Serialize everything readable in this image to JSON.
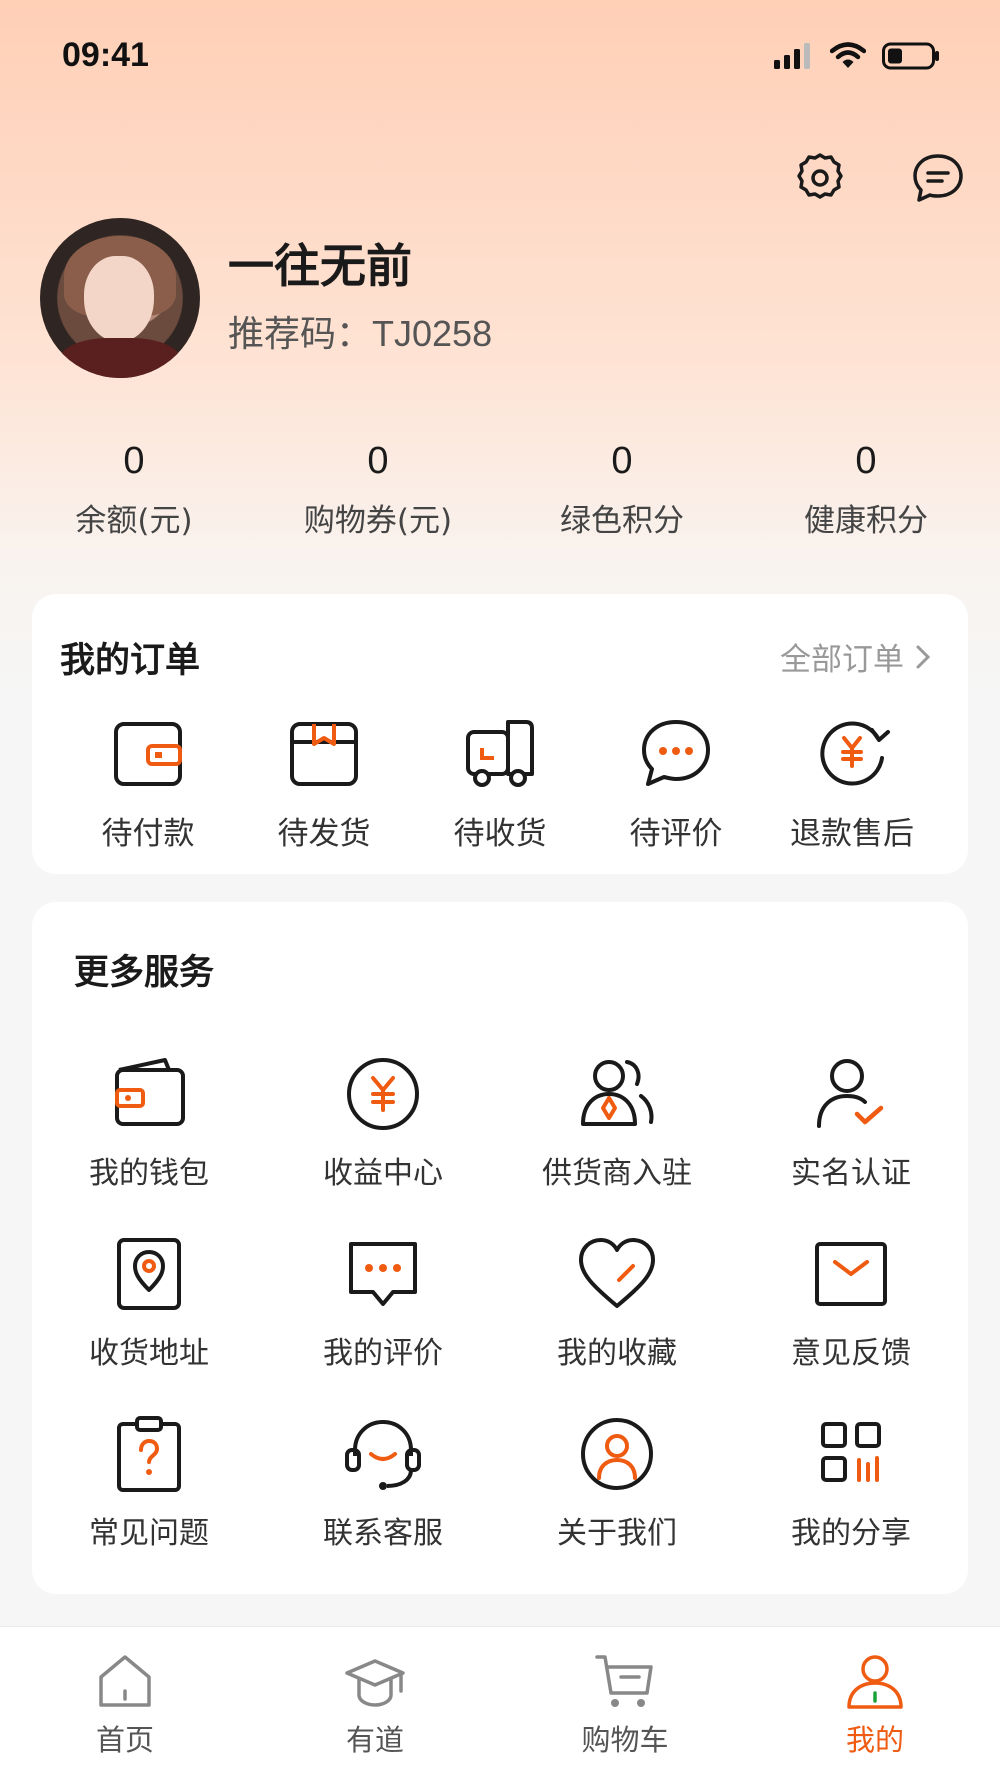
{
  "status_bar": {
    "time": "09:41",
    "signal_icon": "signal-icon",
    "wifi_icon": "wifi-icon",
    "battery_icon": "battery-icon"
  },
  "header": {
    "settings_icon": "gear-icon",
    "message_icon": "message-icon"
  },
  "profile": {
    "name": "一往无前",
    "referral_label": "推荐码：",
    "referral_code": "TJ0258"
  },
  "stats": [
    {
      "value": "0",
      "label": "余额(元)"
    },
    {
      "value": "0",
      "label": "购物券(元)"
    },
    {
      "value": "0",
      "label": "绿色积分"
    },
    {
      "value": "0",
      "label": "健康积分"
    }
  ],
  "orders": {
    "title": "我的订单",
    "all_label": "全部订单",
    "items": [
      {
        "label": "待付款",
        "icon": "wallet-icon"
      },
      {
        "label": "待发货",
        "icon": "box-icon"
      },
      {
        "label": "待收货",
        "icon": "truck-icon"
      },
      {
        "label": "待评价",
        "icon": "chat-bubble-icon"
      },
      {
        "label": "退款售后",
        "icon": "refund-icon"
      }
    ]
  },
  "services": {
    "title": "更多服务",
    "items": [
      {
        "label": "我的钱包",
        "icon": "wallet-icon"
      },
      {
        "label": "收益中心",
        "icon": "yuan-coin-icon"
      },
      {
        "label": "供货商入驻",
        "icon": "supplier-icon"
      },
      {
        "label": "实名认证",
        "icon": "user-check-icon"
      },
      {
        "label": "收货地址",
        "icon": "location-pin-icon"
      },
      {
        "label": "我的评价",
        "icon": "comment-icon"
      },
      {
        "label": "我的收藏",
        "icon": "heart-icon"
      },
      {
        "label": "意见反馈",
        "icon": "envelope-icon"
      },
      {
        "label": "常见问题",
        "icon": "question-clipboard-icon"
      },
      {
        "label": "联系客服",
        "icon": "headset-icon"
      },
      {
        "label": "关于我们",
        "icon": "person-circle-icon"
      },
      {
        "label": "我的分享",
        "icon": "qr-share-icon"
      }
    ]
  },
  "tabs": [
    {
      "label": "首页",
      "icon": "home-icon"
    },
    {
      "label": "有道",
      "icon": "graduation-cap-icon"
    },
    {
      "label": "购物车",
      "icon": "cart-icon"
    },
    {
      "label": "我的",
      "icon": "profile-icon",
      "active": true
    }
  ],
  "colors": {
    "accent": "#f05b12",
    "text": "#1f1f1f",
    "muted": "#999999",
    "header_gradient_top": "#ffcfb6"
  }
}
